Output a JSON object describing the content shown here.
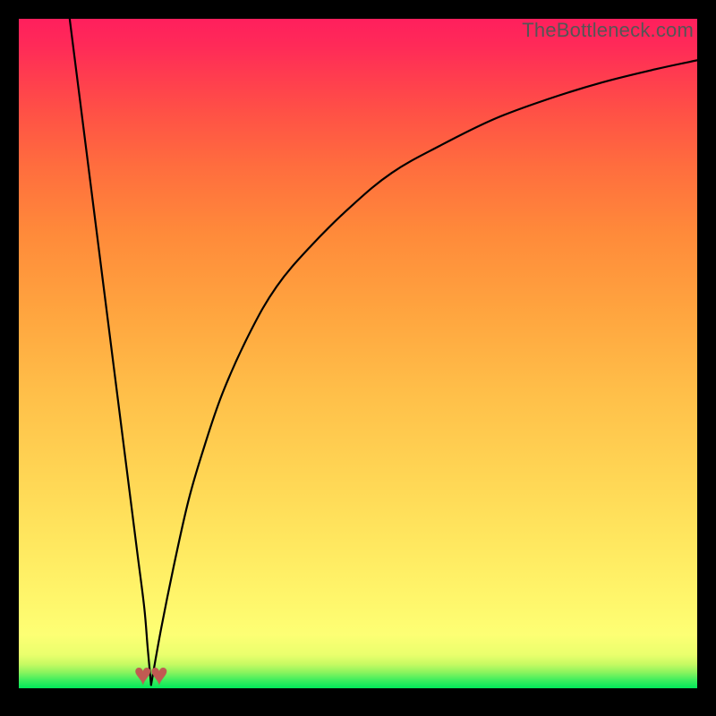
{
  "watermark": {
    "text": "TheBottleneck.com"
  },
  "icons": {
    "heart": "♥"
  },
  "colors": {
    "curve": "#000000",
    "heart": "#c15a52",
    "frame": "#000000"
  },
  "chart_data": {
    "type": "line",
    "title": "",
    "xlabel": "",
    "ylabel": "",
    "xlim": [
      0,
      100
    ],
    "ylim": [
      0,
      100
    ],
    "grid": false,
    "legend": false,
    "annotations": [
      {
        "shape": "heart",
        "x": 18.3,
        "y": 2.0
      },
      {
        "shape": "heart",
        "x": 20.7,
        "y": 2.0
      }
    ],
    "series": [
      {
        "name": "left-branch",
        "x": [
          7.5,
          8.5,
          9.5,
          10.5,
          11.5,
          12.5,
          13.5,
          14.5,
          15.5,
          16.5,
          17.5,
          18.5,
          19.0,
          19.5
        ],
        "y": [
          100,
          92,
          84,
          76,
          68,
          60,
          52,
          44,
          36,
          28,
          20,
          12,
          6,
          0.5
        ]
      },
      {
        "name": "right-branch",
        "x": [
          19.5,
          21,
          23,
          25,
          27,
          30,
          34,
          38,
          43,
          49,
          55,
          62,
          70,
          78,
          86,
          94,
          100
        ],
        "y": [
          0.5,
          9,
          19,
          28,
          35,
          44,
          53,
          60,
          66,
          72,
          77,
          81,
          85,
          88,
          90.5,
          92.5,
          93.8
        ]
      }
    ]
  }
}
